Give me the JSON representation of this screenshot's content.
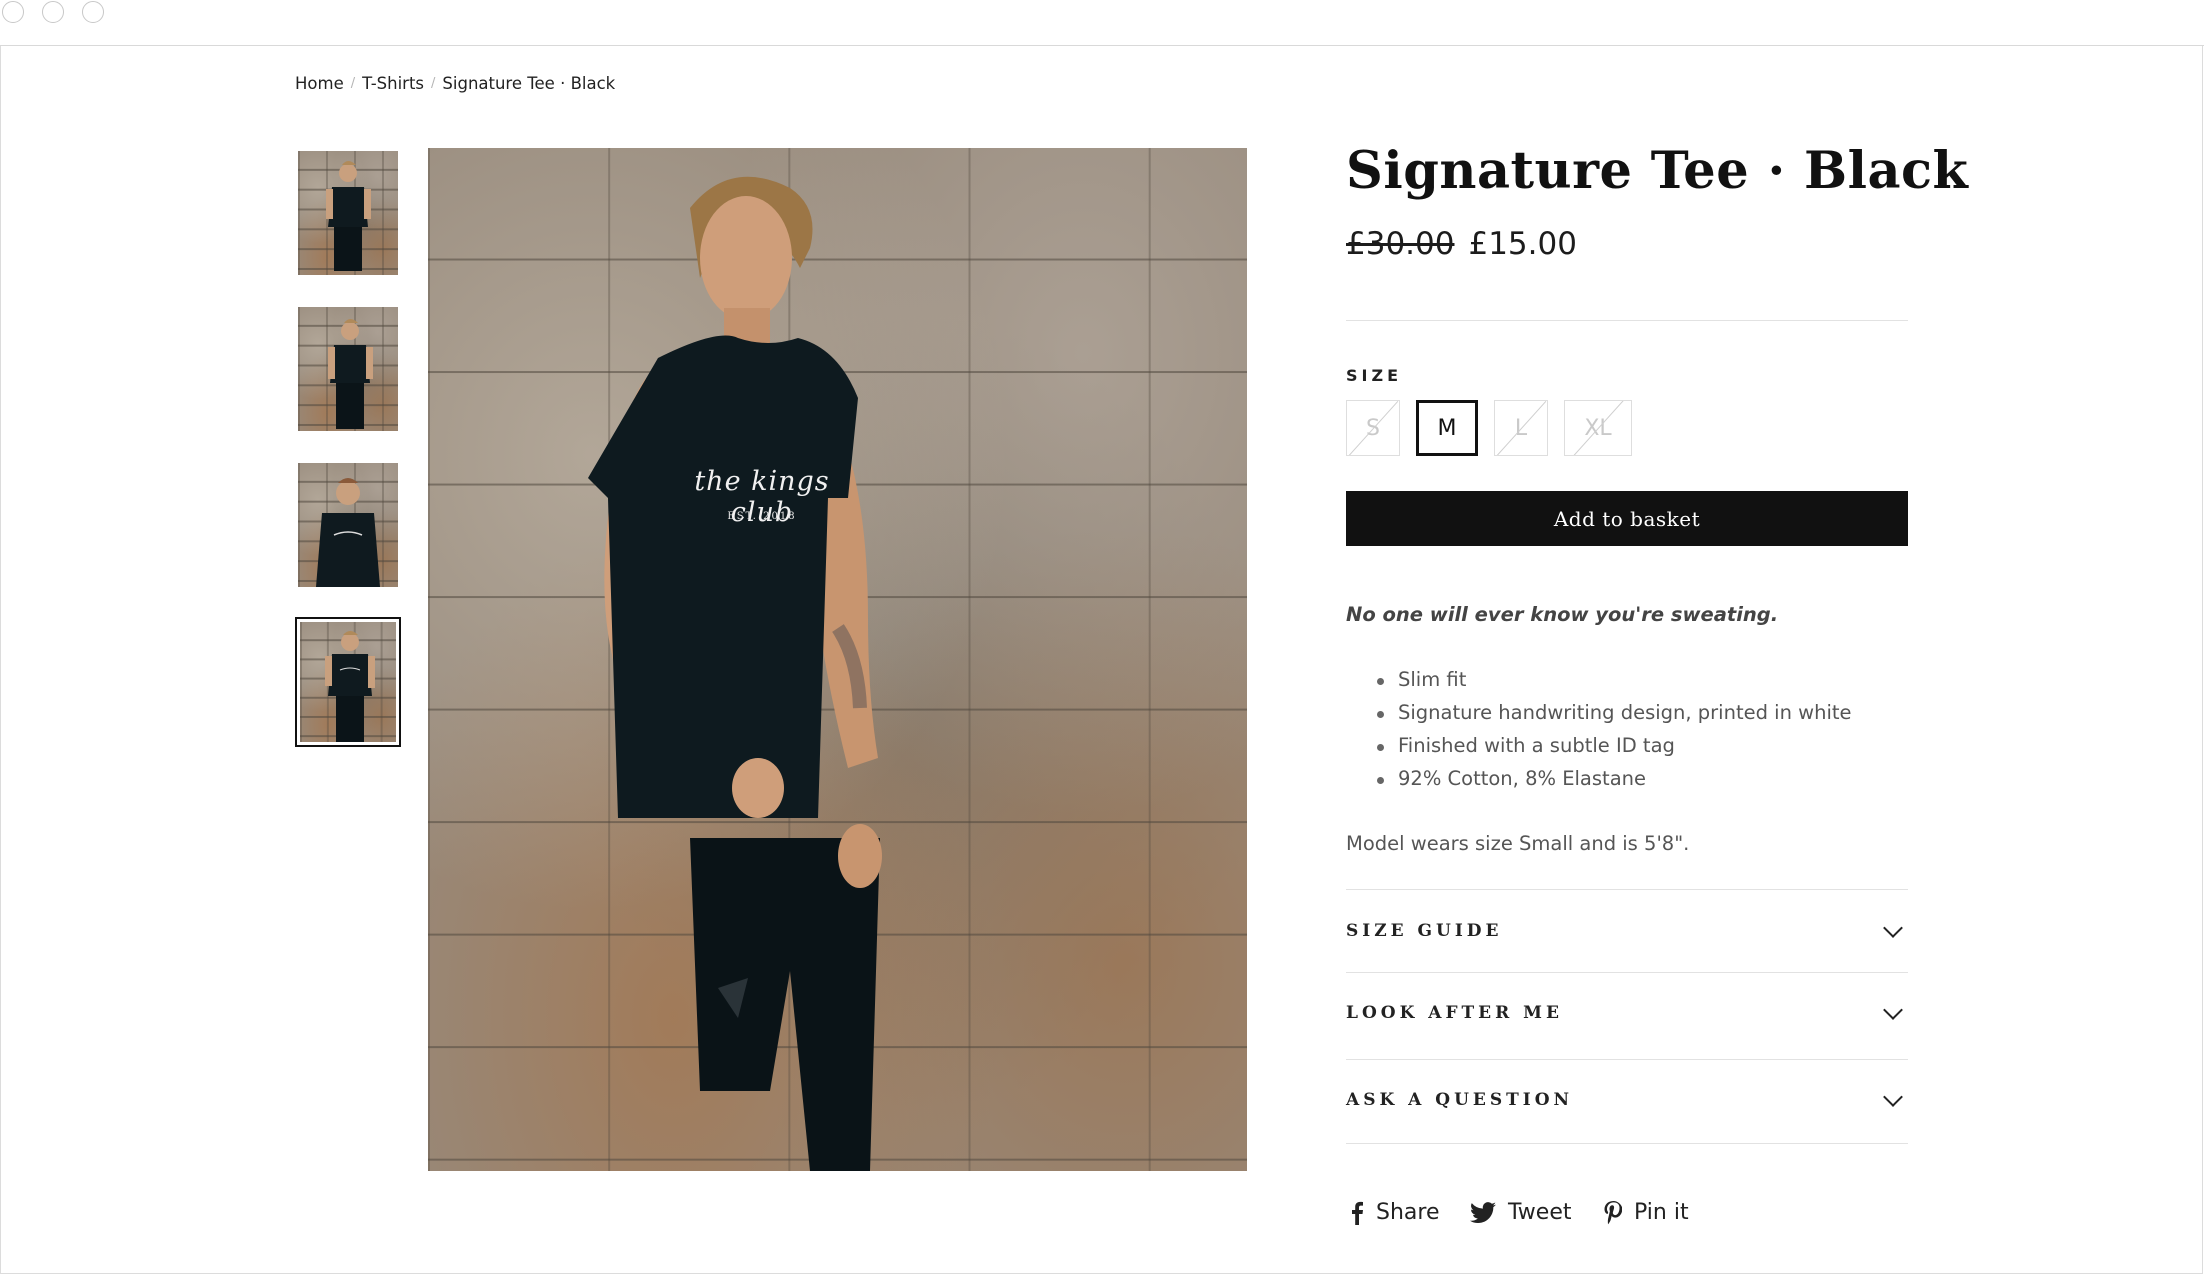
{
  "breadcrumb": {
    "home": "Home",
    "category": "T-Shirts",
    "current": "Signature Tee · Black",
    "separator": "/"
  },
  "gallery": {
    "thumbnails": [
      {
        "label": "thumbnail-1"
      },
      {
        "label": "thumbnail-2"
      },
      {
        "label": "thumbnail-3"
      },
      {
        "label": "thumbnail-4",
        "selected": true
      }
    ],
    "main_image": {
      "print_text": "the kings club",
      "print_subtext": "EST. 2018"
    }
  },
  "product": {
    "title": "Signature Tee · Black",
    "price_original": "£30.00",
    "price_sale": "£15.00",
    "size_label": "SIZE",
    "sizes": [
      {
        "label": "S",
        "available": false
      },
      {
        "label": "M",
        "available": true,
        "selected": true
      },
      {
        "label": "L",
        "available": false
      },
      {
        "label": "XL",
        "available": false
      }
    ],
    "add_to_basket": "Add to basket",
    "tagline": "No one will ever know you're sweating.",
    "features": [
      "Slim fit",
      "Signature handwriting design, printed in white",
      "Finished with a subtle ID tag",
      "92% Cotton, 8% Elastane"
    ],
    "model_note": "Model wears size Small and is 5'8\"."
  },
  "accordions": [
    {
      "label": "SIZE GUIDE",
      "icon": "chevron-down-icon"
    },
    {
      "label": "LOOK AFTER ME",
      "icon": "chevron-down-icon"
    },
    {
      "label": "ASK A QUESTION",
      "icon": "chevron-down-icon"
    }
  ],
  "social": {
    "share": "Share",
    "tweet": "Tweet",
    "pin": "Pin it"
  },
  "colors": {
    "button_bg": "#111111",
    "text": "#1c1c1c",
    "muted": "#555555",
    "border": "#e2e2e2"
  }
}
